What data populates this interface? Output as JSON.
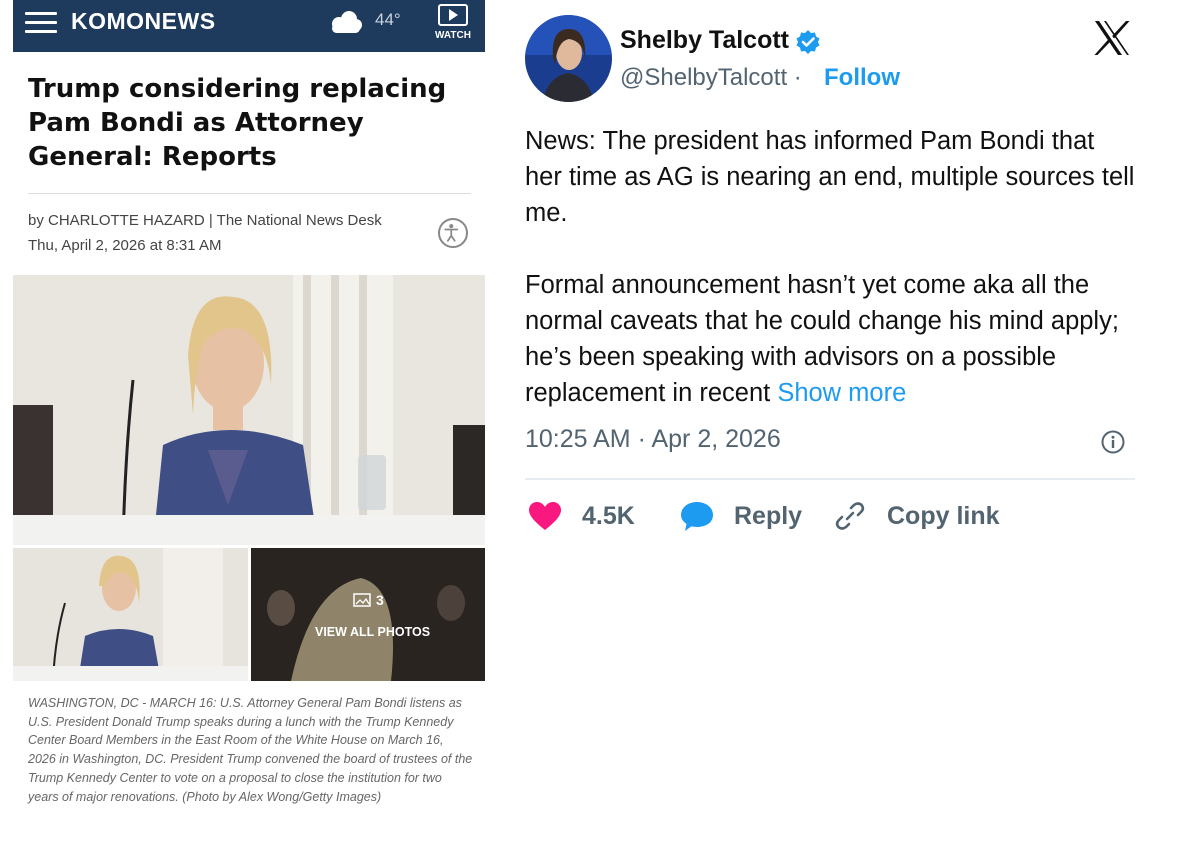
{
  "news": {
    "brand": "KOMONEWS",
    "temperature": "44°",
    "watch_label": "WATCH",
    "headline": "Trump considering replacing Pam Bondi as Attorney General: Reports",
    "byline": "by CHARLOTTE HAZARD | The National News Desk",
    "dateline": "Thu, April 2, 2026 at 8:31 AM",
    "photo_count": "3",
    "view_all_label": "VIEW ALL PHOTOS",
    "caption": "WASHINGTON, DC - MARCH 16: U.S. Attorney General Pam Bondi listens as U.S. President Donald Trump speaks during a lunch with the Trump Kennedy Center Board Members in the East Room of the White House on March 16, 2026 in Washington, DC. President Trump convened the board of trustees of the Trump Kennedy Center to vote on a proposal to close the institution for two years of major renovations. (Photo by Alex Wong/Getty Images)",
    "topbar_color": "#1e3a5c"
  },
  "tweet": {
    "name": "Shelby Talcott",
    "handle": "@ShelbyTalcott",
    "separator": "·",
    "follow_label": "Follow",
    "para1": "News: The president has informed Pam Bondi that her time as AG is nearing an end, multiple sources tell me.",
    "para2": "Formal announcement hasn’t yet come aka all the normal caveats that he could change his mind apply; he’s been speaking with advisors on a possible replacement in recent",
    "show_more": "Show more",
    "timestamp": "10:25 AM · Apr 2, 2026",
    "likes": "4.5K",
    "reply_label": "Reply",
    "copy_link_label": "Copy link",
    "accent_color": "#1d9bf0",
    "heart_color": "#f91880"
  },
  "icons": [
    "hamburger-menu-icon",
    "cloud-icon",
    "play-icon",
    "accessibility-icon",
    "image-icon",
    "verified-badge-icon",
    "x-logo-icon",
    "info-icon",
    "heart-icon",
    "reply-bubble-icon",
    "link-icon"
  ]
}
